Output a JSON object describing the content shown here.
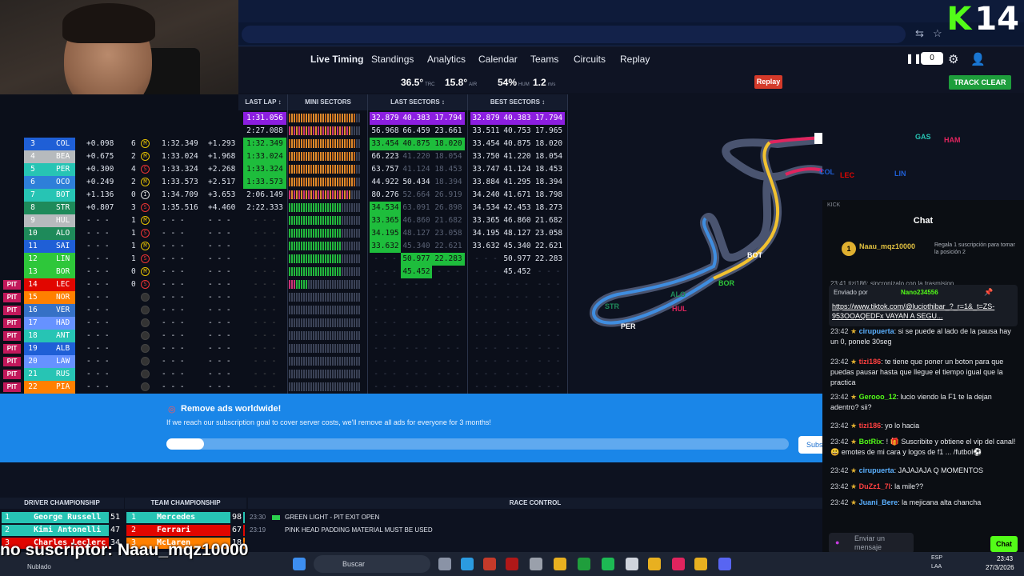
{
  "nav": {
    "tabs": [
      "Live Timing",
      "Standings",
      "Analytics",
      "Calendar",
      "Teams",
      "Circuits",
      "Replay"
    ],
    "active": "Live Timing",
    "replay_count": "0"
  },
  "weather": {
    "track_temp": "36.5°",
    "track_lbl": "TRC",
    "air_temp": "15.8°",
    "air_lbl": "AIR",
    "humidity": "54%",
    "hum_lbl": "HUM",
    "wind": "1.2",
    "wind_lbl": "m/s"
  },
  "buttons": {
    "replay": "Replay",
    "track_clear": "TRACK CLEAR"
  },
  "stream": {
    "kick_number": "14",
    "kick_letter": "K"
  },
  "timing": {
    "headers": {
      "last_lap": "LAST LAP ↕",
      "mini_sectors": "MINI SECTORS",
      "last_sectors": "LAST SECTORS ↕",
      "best_sectors": "BEST SECTORS ↕"
    },
    "top_rows": [
      {
        "last_lap": "1:31.056",
        "s": [
          "32.879",
          "40.383",
          "17.794"
        ],
        "b": [
          "32.879",
          "40.383",
          "17.794"
        ],
        "ll_color": "purple"
      },
      {
        "last_lap": "2:27.088",
        "s": [
          "56.968",
          "66.459",
          "23.661"
        ],
        "b": [
          "33.511",
          "40.753",
          "17.965"
        ],
        "ll_color": "none"
      }
    ],
    "rows": [
      {
        "pit": "",
        "pos": "3",
        "team": "Williams",
        "code": "COL",
        "gap": "+0.098",
        "pits": "6",
        "tyre": "M",
        "best": "1:32.349",
        "int": "+1.293",
        "last_lap": "1:32.349",
        "ll_color": "green",
        "s": [
          "33.454",
          "40.875",
          "18.020"
        ],
        "s_hl": [
          1,
          1,
          1
        ],
        "b": [
          "33.454",
          "40.875",
          "18.020"
        ]
      },
      {
        "pit": "",
        "pos": "4",
        "team": "Haas",
        "code": "BEA",
        "gap": "+0.675",
        "pits": "2",
        "tyre": "M",
        "best": "1:33.024",
        "int": "+1.968",
        "last_lap": "1:33.024",
        "ll_color": "green",
        "s": [
          "66.223",
          "41.220",
          "18.054"
        ],
        "s_hl": [
          0,
          2,
          2
        ],
        "b": [
          "33.750",
          "41.220",
          "18.054"
        ]
      },
      {
        "pit": "",
        "pos": "5",
        "team": "Mercedes",
        "code": "PER",
        "gap": "+0.300",
        "pits": "4",
        "tyre": "S",
        "best": "1:33.324",
        "int": "+2.268",
        "last_lap": "1:33.324",
        "ll_color": "green",
        "s": [
          "63.757",
          "41.124",
          "18.453"
        ],
        "s_hl": [
          0,
          2,
          2
        ],
        "b": [
          "33.747",
          "41.124",
          "18.453"
        ]
      },
      {
        "pit": "",
        "pos": "6",
        "team": "Alpine",
        "code": "OCO",
        "gap": "+0.249",
        "pits": "2",
        "tyre": "M",
        "best": "1:33.573",
        "int": "+2.517",
        "last_lap": "1:33.573",
        "ll_color": "green",
        "s": [
          "44.922",
          "50.434",
          "18.394"
        ],
        "s_hl": [
          0,
          0,
          2
        ],
        "b": [
          "33.884",
          "41.295",
          "18.394"
        ]
      },
      {
        "pit": "",
        "pos": "7",
        "team": "Mercedes",
        "code": "BOT",
        "gap": "+1.136",
        "pits": "0",
        "tyre": "I",
        "best": "1:34.709",
        "int": "+3.653",
        "last_lap": "2:06.149",
        "ll_color": "none",
        "s": [
          "80.276",
          "52.664",
          "26.919"
        ],
        "s_hl": [
          0,
          2,
          2
        ],
        "b": [
          "34.240",
          "41.671",
          "18.798"
        ]
      },
      {
        "pit": "",
        "pos": "8",
        "team": "Aston",
        "code": "STR",
        "gap": "+0.807",
        "pits": "3",
        "tyre": "S",
        "best": "1:35.516",
        "int": "+4.460",
        "last_lap": "2:22.333",
        "ll_color": "none",
        "s": [
          "34.534",
          "63.091",
          "26.898"
        ],
        "s_hl": [
          1,
          2,
          2
        ],
        "b": [
          "34.534",
          "42.453",
          "18.273"
        ]
      },
      {
        "pit": "",
        "pos": "9",
        "team": "Haas",
        "code": "HUL",
        "gap": "- - -",
        "pits": "1",
        "tyre": "M",
        "best": "- - -",
        "int": "- - -",
        "last_lap": "- - -",
        "ll_color": "none",
        "s": [
          "33.365",
          "46.860",
          "21.682"
        ],
        "s_hl": [
          1,
          2,
          2
        ],
        "b": [
          "33.365",
          "46.860",
          "21.682"
        ]
      },
      {
        "pit": "",
        "pos": "10",
        "team": "Aston",
        "code": "ALO",
        "gap": "- - -",
        "pits": "1",
        "tyre": "S",
        "best": "- - -",
        "int": "- - -",
        "last_lap": "- - -",
        "ll_color": "none",
        "s": [
          "34.195",
          "48.127",
          "23.058"
        ],
        "s_hl": [
          1,
          2,
          2
        ],
        "b": [
          "34.195",
          "48.127",
          "23.058"
        ]
      },
      {
        "pit": "",
        "pos": "11",
        "team": "Williams",
        "code": "SAI",
        "gap": "- - -",
        "pits": "1",
        "tyre": "M",
        "best": "- - -",
        "int": "- - -",
        "last_lap": "- - -",
        "ll_color": "none",
        "s": [
          "33.632",
          "45.340",
          "22.621"
        ],
        "s_hl": [
          1,
          2,
          2
        ],
        "b": [
          "33.632",
          "45.340",
          "22.621"
        ]
      },
      {
        "pit": "",
        "pos": "12",
        "team": "Kick",
        "code": "LIN",
        "gap": "- - -",
        "pits": "1",
        "tyre": "S",
        "best": "- - -",
        "int": "- - -",
        "last_lap": "- - -",
        "ll_color": "none",
        "s": [
          "",
          "50.977",
          "22.283"
        ],
        "s_hl": [
          0,
          1,
          1
        ],
        "b": [
          "",
          "50.977",
          "22.283"
        ]
      },
      {
        "pit": "",
        "pos": "13",
        "team": "Kick",
        "code": "BOR",
        "gap": "- - -",
        "pits": "0",
        "tyre": "M",
        "best": "- - -",
        "int": "- - -",
        "last_lap": "- - -",
        "ll_color": "none",
        "s": [
          "",
          "45.452",
          ""
        ],
        "s_hl": [
          0,
          1,
          0
        ],
        "b": [
          "",
          "45.452",
          ""
        ]
      },
      {
        "pit": "PIT",
        "pos": "14",
        "team": "Ferrari",
        "code": "LEC",
        "gap": "- - -",
        "pits": "0",
        "tyre": "S",
        "best": "- - -",
        "int": "- - -",
        "last_lap": "- - -",
        "ll_color": "none",
        "s": [
          "",
          "",
          ""
        ],
        "s_hl": [
          0,
          0,
          0
        ],
        "b": [
          "",
          "",
          ""
        ]
      },
      {
        "pit": "PIT",
        "pos": "15",
        "team": "McLaren",
        "code": "NOR",
        "gap": "- - -",
        "pits": "",
        "tyre": "",
        "best": "- - -",
        "int": "- - -",
        "last_lap": "- - -",
        "ll_color": "none",
        "s": [
          "",
          "",
          ""
        ],
        "s_hl": [
          0,
          0,
          0
        ],
        "b": [
          "",
          "",
          ""
        ]
      },
      {
        "pit": "PIT",
        "pos": "16",
        "team": "RedBull",
        "code": "VER",
        "gap": "- - -",
        "pits": "",
        "tyre": "",
        "best": "- - -",
        "int": "- - -",
        "last_lap": "- - -",
        "ll_color": "none",
        "s": [
          "",
          "",
          ""
        ],
        "s_hl": [
          0,
          0,
          0
        ],
        "b": [
          "",
          "",
          ""
        ]
      },
      {
        "pit": "PIT",
        "pos": "17",
        "team": "RB",
        "code": "HAD",
        "gap": "- - -",
        "pits": "",
        "tyre": "",
        "best": "- - -",
        "int": "- - -",
        "last_lap": "- - -",
        "ll_color": "none",
        "s": [
          "",
          "",
          ""
        ],
        "s_hl": [
          0,
          0,
          0
        ],
        "b": [
          "",
          "",
          ""
        ]
      },
      {
        "pit": "PIT",
        "pos": "18",
        "team": "Mercedes",
        "code": "ANT",
        "gap": "- - -",
        "pits": "",
        "tyre": "",
        "best": "- - -",
        "int": "- - -",
        "last_lap": "- - -",
        "ll_color": "none",
        "s": [
          "",
          "",
          ""
        ],
        "s_hl": [
          0,
          0,
          0
        ],
        "b": [
          "",
          "",
          ""
        ]
      },
      {
        "pit": "PIT",
        "pos": "19",
        "team": "Williams",
        "code": "ALB",
        "gap": "- - -",
        "pits": "",
        "tyre": "",
        "best": "- - -",
        "int": "- - -",
        "last_lap": "- - -",
        "ll_color": "none",
        "s": [
          "",
          "",
          ""
        ],
        "s_hl": [
          0,
          0,
          0
        ],
        "b": [
          "",
          "",
          ""
        ]
      },
      {
        "pit": "PIT",
        "pos": "20",
        "team": "RB",
        "code": "LAW",
        "gap": "- - -",
        "pits": "",
        "tyre": "",
        "best": "- - -",
        "int": "- - -",
        "last_lap": "- - -",
        "ll_color": "none",
        "s": [
          "",
          "",
          ""
        ],
        "s_hl": [
          0,
          0,
          0
        ],
        "b": [
          "",
          "",
          ""
        ]
      },
      {
        "pit": "PIT",
        "pos": "21",
        "team": "Mercedes",
        "code": "RUS",
        "gap": "- - -",
        "pits": "",
        "tyre": "",
        "best": "- - -",
        "int": "- - -",
        "last_lap": "- - -",
        "ll_color": "none",
        "s": [
          "",
          "",
          ""
        ],
        "s_hl": [
          0,
          0,
          0
        ],
        "b": [
          "",
          "",
          ""
        ]
      },
      {
        "pit": "PIT",
        "pos": "22",
        "team": "McLaren",
        "code": "PIA",
        "gap": "- - -",
        "pits": "",
        "tyre": "",
        "best": "- - -",
        "int": "- - -",
        "last_lap": "- - -",
        "ll_color": "none",
        "s": [
          "",
          "",
          ""
        ],
        "s_hl": [
          0,
          0,
          0
        ],
        "b": [
          "",
          "",
          ""
        ]
      }
    ]
  },
  "team_colors": {
    "Williams": "#1f5fd6",
    "Haas": "#b6babd",
    "Mercedes": "#27c4b4",
    "Alpine": "#2e7fd9",
    "Aston": "#1e8a5a",
    "Kick": "#2ec73a",
    "Ferrari": "#e10600",
    "McLaren": "#ff8000",
    "RedBull": "#3671c6",
    "RB": "#6692ff"
  },
  "map_labels": [
    "GAS",
    "HAM",
    "COL",
    "LEC",
    "LIN",
    "BOT",
    "BOR",
    "ALO",
    "HUL",
    "STR",
    "PER"
  ],
  "banner": {
    "title": "Remove ads worldwide!",
    "desc": "If we reach our subscription goal to cover server costs, we'll remove all ads for everyone for 3 months!",
    "progress": 0.06,
    "subscribe": "Subs"
  },
  "standings": {
    "driver_title": "DRIVER CHAMPIONSHIP",
    "team_title": "TEAM CHAMPIONSHIP",
    "race_control_title": "RACE CONTROL",
    "drivers": [
      {
        "pos": "1",
        "name": "George Russell",
        "pts": "51",
        "color": "#27c4b4"
      },
      {
        "pos": "2",
        "name": "Kimi Antonelli",
        "pts": "47",
        "color": "#27c4b4"
      },
      {
        "pos": "3",
        "name": "Charles Leclerc",
        "pts": "34",
        "color": "#e10600"
      }
    ],
    "teams": [
      {
        "pos": "1",
        "name": "Mercedes",
        "pts": "98",
        "color": "#27c4b4"
      },
      {
        "pos": "2",
        "name": "Ferrari",
        "pts": "67",
        "color": "#e10600"
      },
      {
        "pos": "3",
        "name": "McLaren",
        "pts": "18",
        "color": "#ff8000"
      }
    ],
    "race_control": [
      {
        "time": "23:30",
        "text": "GREEN LIGHT - PIT EXIT OPEN",
        "flag": true
      },
      {
        "time": "23:19",
        "text": "PINK HEAD PADDING MATERIAL MUST BE USED",
        "flag": false
      }
    ]
  },
  "chat": {
    "kick_label": "KICK",
    "title": "Chat",
    "sub_user": "Naau_mqz10000",
    "sub_count": "1",
    "gift_text": "Regala 1 suscripción para tomar la posición 2",
    "pinned_by": "Enviado por",
    "pinned_user": "Nano234556",
    "pinned_link": "https://www.tiktok.com/@luciothibar_?_r=1&_t=ZS-953OOAQEDFx VAYAN A SEGU...",
    "partial_top": "23:41 tizi186: sincronizalo con la trasmision",
    "messages": [
      {
        "time": "23:42",
        "user": "cirupuerta",
        "color": "#5ab0ff",
        "text": ": si se puede al lado de la pausa hay un 0, ponele 30seg"
      },
      {
        "time": "23:42",
        "user": "tizi186",
        "color": "#ff4040",
        "text": ": te tiene que poner un boton para que puedas pausar hasta que llegue el tiempo igual que la practica"
      },
      {
        "time": "23:42",
        "user": "Gerooo_12",
        "color": "#53fc18",
        "text": ": lucio viendo la F1 te la dejan adentro? sii?"
      },
      {
        "time": "23:42",
        "user": "tizi186",
        "color": "#ff4040",
        "text": ": yo lo hacia"
      },
      {
        "time": "23:42",
        "user": "BotRix",
        "color": "#53fc18",
        "text": ": ! 🎁 Suscribite y obtiene el vip del canal! 😃 emotes de mi cara y logos de f1 ... /futbol⚽"
      },
      {
        "time": "23:42",
        "user": "cirupuerta",
        "color": "#5ab0ff",
        "text": ": JAJAJAJA Q MOMENTOS"
      },
      {
        "time": "23:42",
        "user": "DuZz1_7l",
        "color": "#ff4040",
        "text": ": la mile??"
      },
      {
        "time": "23:42",
        "user": "Juani_Bere",
        "color": "#5ab0ff",
        "text": ": la mejicana alta chancha"
      }
    ],
    "input_placeholder": "Enviar un mensaje",
    "send": "Chat"
  },
  "caption": "no suscriptor: Naau_mqz10000",
  "taskbar": {
    "search": "Buscar",
    "weather": "Nublado",
    "lang": "ESP",
    "region": "LAA",
    "time": "23:43",
    "date": "27/3/2026"
  }
}
